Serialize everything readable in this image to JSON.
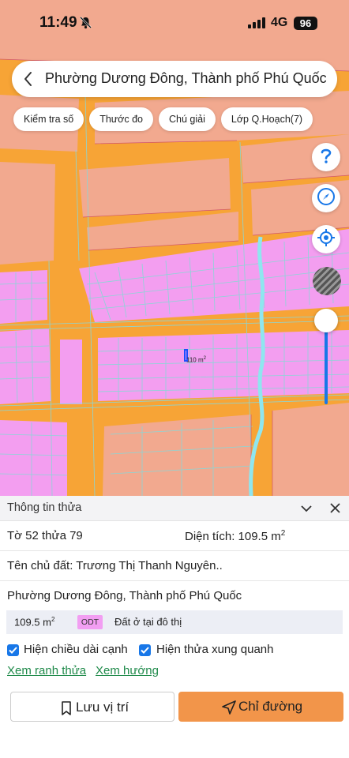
{
  "status_bar": {
    "time": "11:49",
    "network": "4G",
    "battery": "96"
  },
  "search": {
    "title": "Phường Dương Đông, Thành phố Phú Quốc"
  },
  "chips": [
    "Kiểm tra số",
    "Thước đo",
    "Chú giải",
    "Lớp Q.Hoạch(7)"
  ],
  "map": {
    "parcel_area_label": "110 m",
    "colors": {
      "road": "#f7a436",
      "residential": "#f39ef0",
      "zone": "#f2a98f",
      "parcel_line": "#8ad6d6",
      "water": "#8fe6ef"
    }
  },
  "panel": {
    "title": "Thông tin thửa",
    "sheet_parcel": "Tờ 52 thửa 79",
    "area_label": "Diện tích: 109.5 m",
    "owner": "Tên chủ đất: Trương Thị Thanh Nguyên..",
    "address": "Phường Dương Đông, Thành phố Phú Quốc",
    "land_use": {
      "area": "109.5 m",
      "code": "ODT",
      "description": "Đất ở tại đô thị"
    },
    "options": [
      {
        "label": "Hiện chiều dài cạnh",
        "checked": true
      },
      {
        "label": "Hiện thửa xung quanh",
        "checked": true
      }
    ],
    "links": [
      "Xem ranh thửa",
      "Xem hướng"
    ],
    "save_label": "Lưu vị trí",
    "directions_label": "Chỉ đường"
  }
}
